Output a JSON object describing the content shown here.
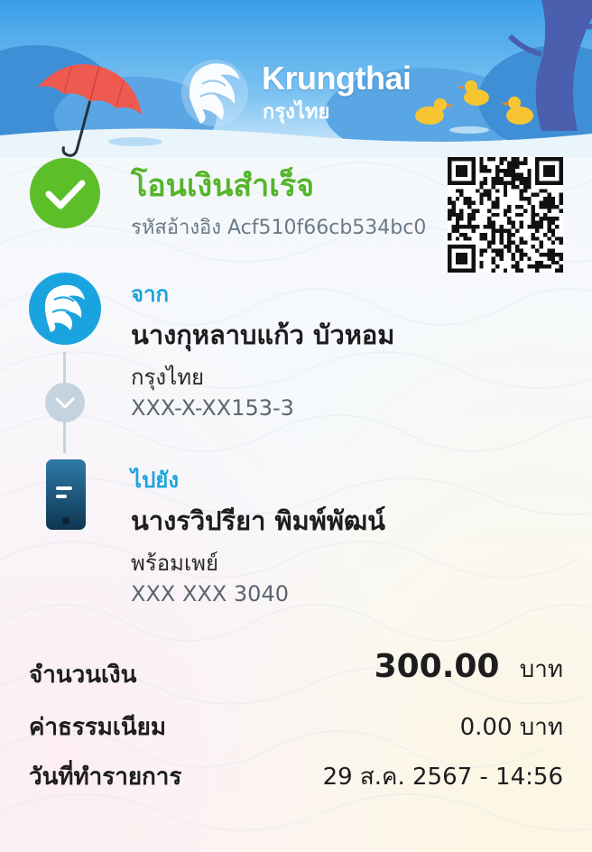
{
  "brand": {
    "name_en": "Krungthai",
    "name_th": "กรุงไทย"
  },
  "status": {
    "title": "โอนเงินสำเร็จ",
    "reference": "รหัสอ้างอิง Acf510f66cb534bc0"
  },
  "sender": {
    "section_label": "จาก",
    "name": "นางกุหลาบแก้ว บัวหอม",
    "bank": "กรุงไทย",
    "account": "XXX-X-XX153-3"
  },
  "receiver": {
    "section_label": "ไปยัง",
    "name": "นางรวิปรียา   พิมพ์พัฒน์",
    "bank": "พร้อมเพย์",
    "account": "XXX XXX 3040"
  },
  "summary": {
    "amount_label": "จำนวนเงิน",
    "amount_value": "300.00",
    "amount_unit": "บาท",
    "fee_label": "ค่าธรรมเนียม",
    "fee_value": "0.00 บาท",
    "date_label": "วันที่ทำรายการ",
    "date_value": "29 ส.ค. 2567 - 14:56"
  },
  "colors": {
    "success_green": "#5cbf2a",
    "accent_blue": "#1aa4df",
    "text_dark": "#1d1d1f",
    "text_muted": "#6a7a88"
  },
  "icons": [
    "check-icon",
    "krungthai-bank-icon",
    "chevron-down-icon",
    "mobile-phone-icon",
    "qr-code-icon",
    "umbrella-icon",
    "duck-icon"
  ]
}
